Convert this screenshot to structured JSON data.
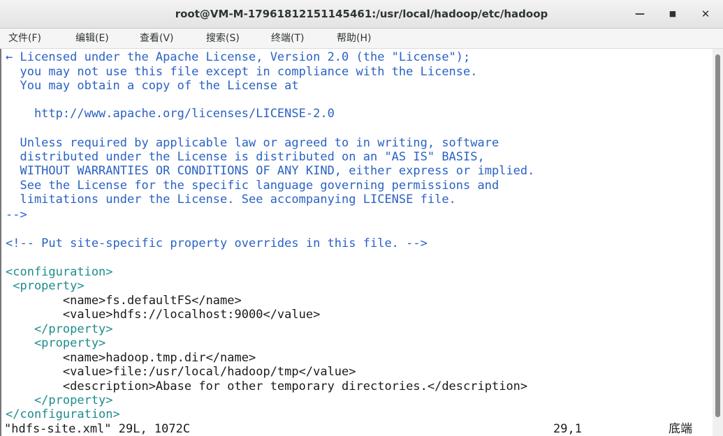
{
  "window": {
    "title": "root@VM-M-17961812151145461:/usr/local/hadoop/etc/hadoop",
    "minimize_icon": "minimize-icon",
    "maximize_icon": "maximize-icon",
    "close_icon": "close-icon"
  },
  "menu": {
    "file": "文件(F)",
    "edit": "编辑(E)",
    "view": "查看(V)",
    "search": "搜索(S)",
    "terminal": "终端(T)",
    "help": "帮助(H)"
  },
  "editor": {
    "lines": [
      "← Licensed under the Apache License, Version 2.0 (the \"License\");",
      "  you may not use this file except in compliance with the License.",
      "  You may obtain a copy of the License at",
      "",
      "    http://www.apache.org/licenses/LICENSE-2.0",
      "",
      "  Unless required by applicable law or agreed to in writing, software",
      "  distributed under the License is distributed on an \"AS IS\" BASIS,",
      "  WITHOUT WARRANTIES OR CONDITIONS OF ANY KIND, either express or implied.",
      "  See the License for the specific language governing permissions and",
      "  limitations under the License. See accompanying LICENSE file.",
      "-->",
      "",
      "<!-- Put site-specific property overrides in this file. -->",
      "",
      "<configuration>",
      " <property>",
      "        <name>fs.defaultFS</name>",
      "        <value>hdfs://localhost:9000</value>",
      "    </property>",
      "    <property>",
      "        <name>hadoop.tmp.dir</name>",
      "        <value>file:/usr/local/hadoop/tmp</value>",
      "        <description>Abase for other temporary directories.</description>",
      "    </property>",
      "</configuration>"
    ]
  },
  "status": {
    "file_info": "\"hdfs-site.xml\" 29L, 1072C",
    "position": "29,1",
    "scroll": "底端"
  }
}
